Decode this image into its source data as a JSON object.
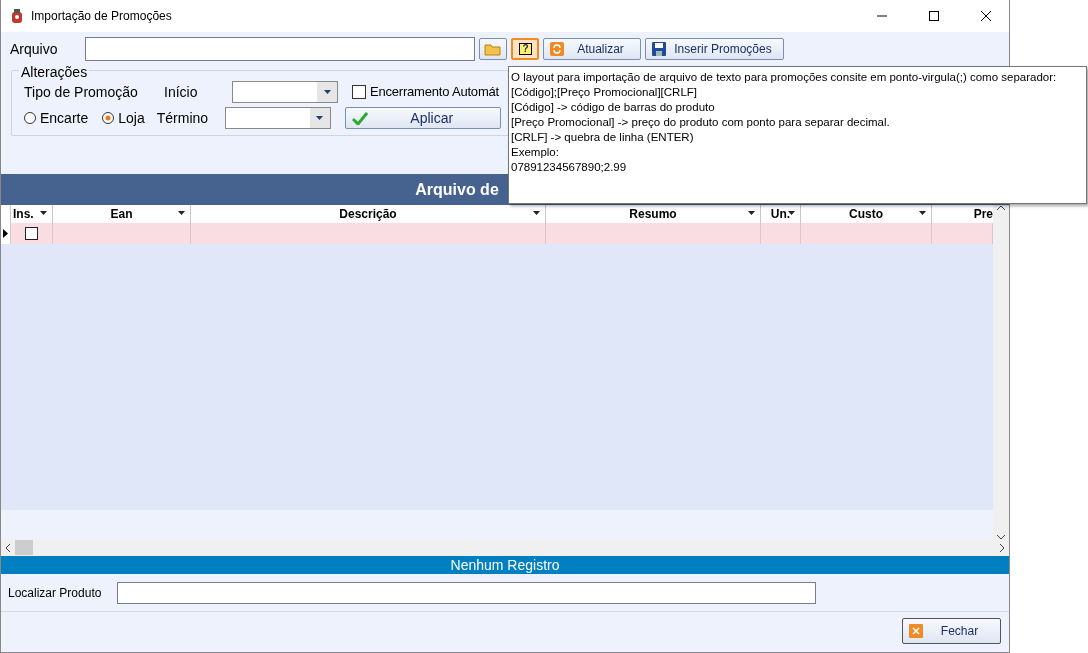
{
  "window": {
    "title": "Importação de Promoções"
  },
  "file_row": {
    "label": "Arquivo",
    "help_pressed": true,
    "help_glyph": "?",
    "buttons": [
      {
        "kind": "refresh",
        "label": "Atualizar"
      },
      {
        "kind": "save",
        "label": "Inserir Promoções"
      }
    ]
  },
  "changes": {
    "title": "Alterações",
    "type_label": "Tipo de Promoção",
    "radios": [
      {
        "label": "Encarte",
        "selected": false
      },
      {
        "label": "Loja",
        "selected": true
      }
    ],
    "dates": [
      {
        "label": "Início"
      },
      {
        "label": "Término"
      }
    ],
    "auto_close": {
      "label": "Encerramento Automát",
      "checked": false
    },
    "apply": "Aplicar"
  },
  "tooltip": [
    "O layout para importação de arquivo de texto para promoções consite em ponto-virgula(;) como separador:",
    "[Código];[Preço Promocional][CRLF]",
    "[Código] -> código de barras do produto",
    "[Preço Promocional] -> preço do produto com ponto para separar decimal.",
    "[CRLF] -> quebra de linha (ENTER)",
    "Exemplo:",
    "07891234567890;2.99"
  ],
  "grid": {
    "title": "Arquivo de",
    "columns": [
      "Ins.",
      "Ean",
      "Descrição",
      "Resumo",
      "Un.",
      "Custo",
      "Pre"
    ],
    "rows": [
      {
        "current": true,
        "checked": false
      }
    ],
    "status": "Nenhum Registro"
  },
  "search": {
    "label": "Localizar Produto"
  },
  "close": "Fechar"
}
